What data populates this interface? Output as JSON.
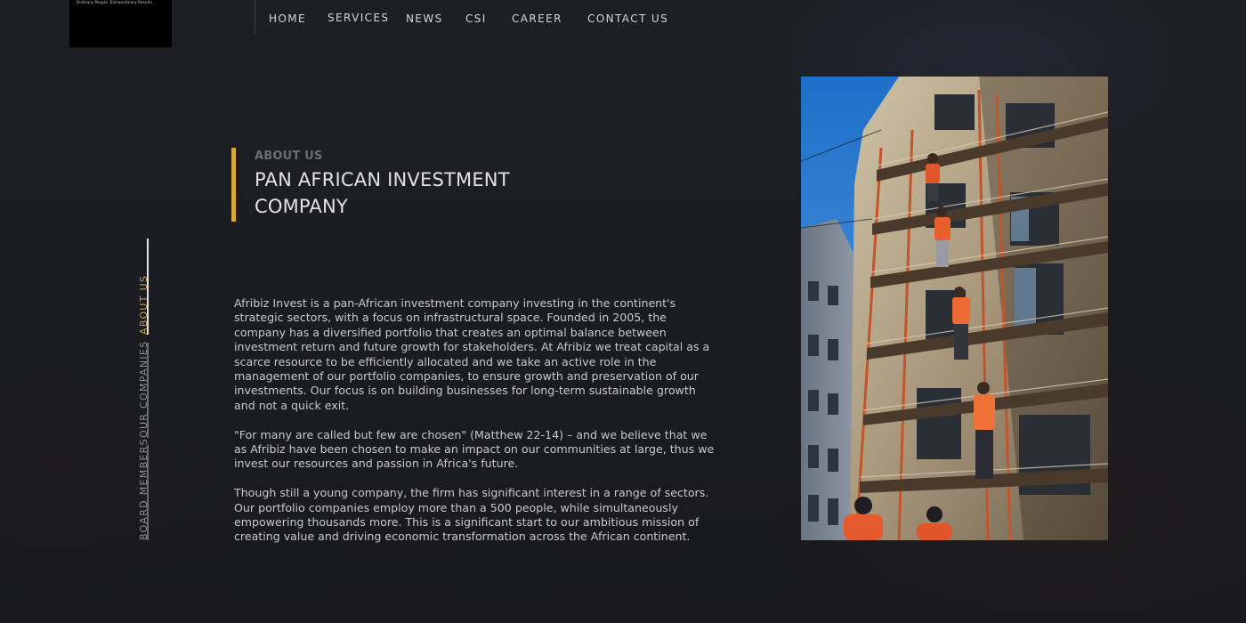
{
  "brand": {
    "tagline": "Ordinary People. Extraordinary Results"
  },
  "nav": {
    "items": [
      {
        "label": "HOME"
      },
      {
        "label": "SERVICES"
      },
      {
        "label": "NEWS"
      },
      {
        "label": "CSI"
      },
      {
        "label": "CAREER"
      },
      {
        "label": "CONTACT US"
      }
    ]
  },
  "side_nav": {
    "items": [
      {
        "label": "ABOUT US",
        "active": true
      },
      {
        "label": "OUR COMPANIES",
        "active": false
      },
      {
        "label": "BOARD MEMBERS",
        "active": false
      }
    ]
  },
  "about": {
    "eyebrow": "ABOUT US",
    "title": "PAN AFRICAN INVESTMENT COMPANY",
    "paragraphs": [
      "Afribiz Invest is a pan-African investment company investing in the continent's strategic sectors, with a focus on infrastructural space. Founded in 2005, the company has a diversified portfolio that creates an optimal balance between investment return and future growth for stakeholders. At Afribiz we treat capital as a scarce resource to be efficiently allocated and we take an active role in the management of our portfolio companies, to ensure growth and preservation of our investments. Our focus is on building businesses for long-term sustainable growth and not a quick exit.",
      "\"For many are called but few are chosen\" (Matthew 22-14) – and we believe that we as Afribiz have been chosen to make an impact on our communities at large, thus we invest our resources and passion in Africa's future.",
      "Though still a young company, the firm has significant interest in a range of sectors. Our portfolio companies employ more than a 500 people, while simultaneously empowering thousands more. This is a significant start to our ambitious mission of creating value and driving economic transformation across the African continent."
    ]
  },
  "colors": {
    "accent": "#d9aa3a",
    "background": "#1b1d22",
    "text": "#c9c9c9",
    "active_side": "#c9a045"
  }
}
